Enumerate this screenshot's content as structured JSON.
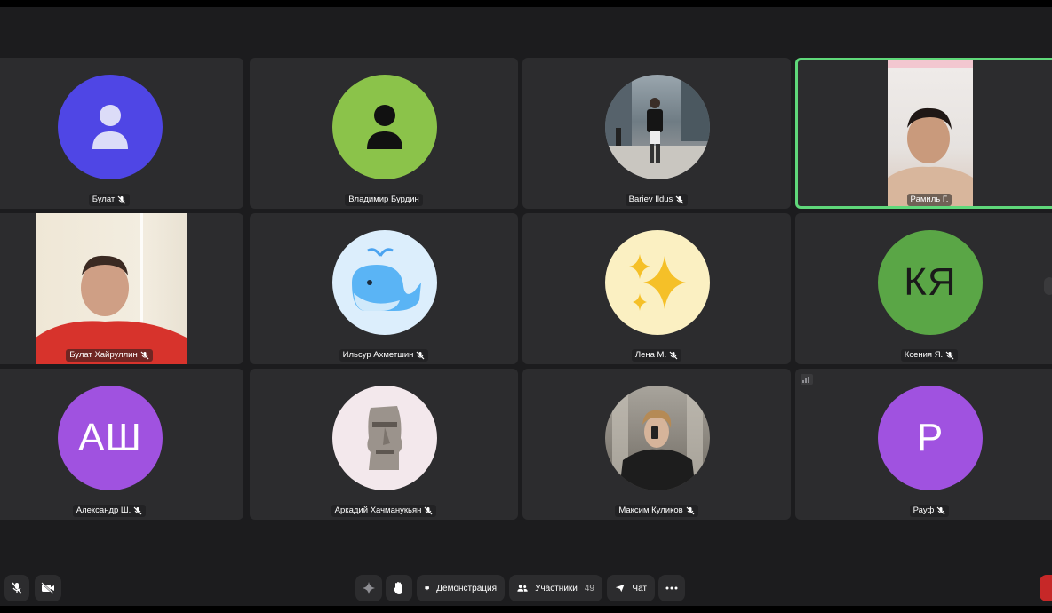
{
  "colors": {
    "background": "#1c1c1e",
    "tile": "#2c2c2e",
    "active_speaker_border": "#5fd87a"
  },
  "participants": [
    {
      "name": "Булат",
      "avatar": "user-icon",
      "avatar_color": "#4f46e5",
      "muted": true
    },
    {
      "name": "Владимир Бурдин",
      "avatar": "user-icon",
      "avatar_color": "#8bc34a",
      "muted": false
    },
    {
      "name": "Bariev Ildus",
      "avatar": "photo",
      "muted": true
    },
    {
      "name": "Рамиль Г.",
      "avatar": "video",
      "muted": false,
      "speaking": true
    },
    {
      "name": "Булат Хайруллин",
      "avatar": "video",
      "muted": true
    },
    {
      "name": "Ильсур Ахметшин",
      "avatar": "whale-emoji",
      "avatar_color": "#dceefc",
      "muted": true
    },
    {
      "name": "Лена М.",
      "avatar": "sparkles-emoji",
      "avatar_color": "#fbf0c2",
      "muted": true
    },
    {
      "name": "Ксения Я.",
      "avatar": "initials",
      "initials": "КЯ",
      "avatar_color": "#5aa646",
      "muted": true
    },
    {
      "name": "Александр Ш.",
      "avatar": "initials",
      "initials": "АШ",
      "avatar_color": "#a052e0",
      "muted": true
    },
    {
      "name": "Аркадий Хачманукьян",
      "avatar": "moai-emoji",
      "avatar_color": "#f3e8ec",
      "muted": true
    },
    {
      "name": "Максим Куликов",
      "avatar": "photo",
      "muted": true
    },
    {
      "name": "Рауф",
      "avatar": "initials",
      "initials": "Р",
      "avatar_color": "#a052e0",
      "muted": true
    }
  ],
  "toolbar": {
    "mic": "mic-off-icon",
    "camera": "camera-off-icon",
    "effects": "sparkle-icon",
    "raise_hand": "hand-icon",
    "screen_share_label": "Демонстрация",
    "participants_label": "Участники",
    "participants_count": "49",
    "chat_label": "Чат",
    "more": "more-icon"
  }
}
